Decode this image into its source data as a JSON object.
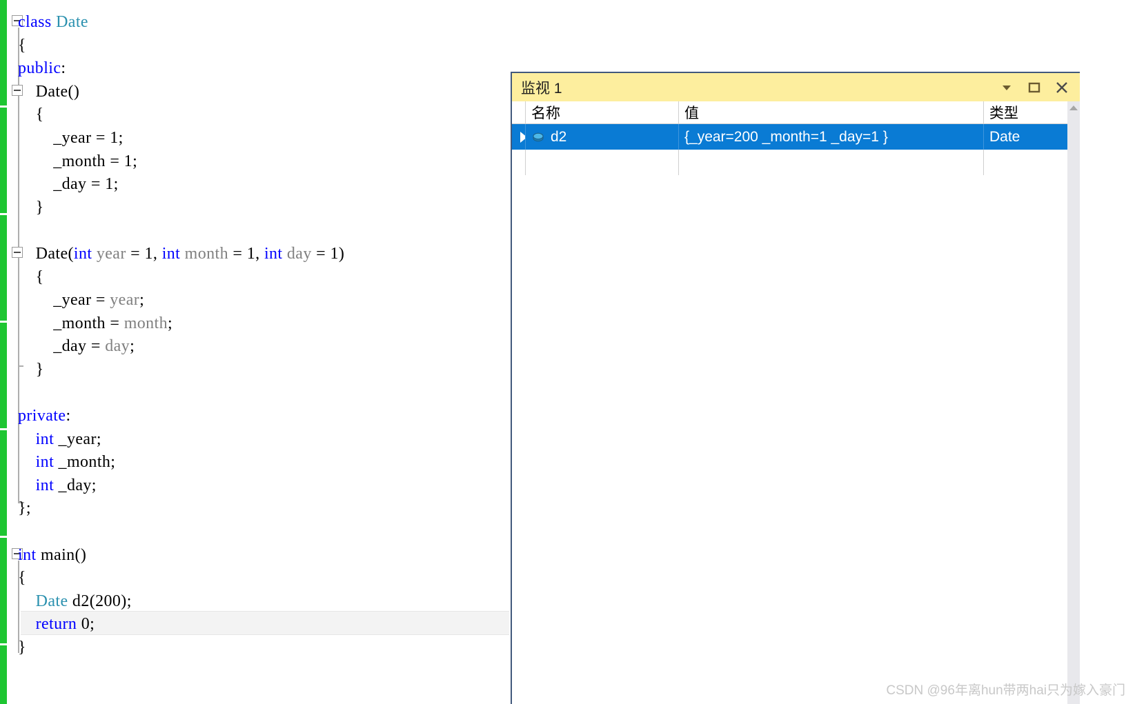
{
  "editor": {
    "language": "cpp",
    "change_bar_color": "#1ec632",
    "current_line_index": 24,
    "lines": [
      {
        "indent": 0,
        "tokens": [
          {
            "t": "class ",
            "c": "kw"
          },
          {
            "t": "Date",
            "c": "type"
          }
        ]
      },
      {
        "indent": 0,
        "tokens": [
          {
            "t": "{",
            "c": "pl"
          }
        ]
      },
      {
        "indent": 0,
        "tokens": [
          {
            "t": "public",
            "c": "kw"
          },
          {
            "t": ":",
            "c": "pl"
          }
        ]
      },
      {
        "indent": 1,
        "tokens": [
          {
            "t": "Date()",
            "c": "pl"
          }
        ]
      },
      {
        "indent": 1,
        "tokens": [
          {
            "t": "{",
            "c": "pl"
          }
        ]
      },
      {
        "indent": 2,
        "tokens": [
          {
            "t": "_year = 1;",
            "c": "pl"
          }
        ]
      },
      {
        "indent": 2,
        "tokens": [
          {
            "t": "_month = 1;",
            "c": "pl"
          }
        ]
      },
      {
        "indent": 2,
        "tokens": [
          {
            "t": "_day = 1;",
            "c": "pl"
          }
        ]
      },
      {
        "indent": 1,
        "tokens": [
          {
            "t": "}",
            "c": "pl"
          }
        ]
      },
      {
        "indent": 0,
        "tokens": []
      },
      {
        "indent": 1,
        "tokens": [
          {
            "t": "Date(",
            "c": "pl"
          },
          {
            "t": "int",
            "c": "kw"
          },
          {
            "t": " ",
            "c": "pl"
          },
          {
            "t": "year",
            "c": "param"
          },
          {
            "t": " = 1, ",
            "c": "pl"
          },
          {
            "t": "int",
            "c": "kw"
          },
          {
            "t": " ",
            "c": "pl"
          },
          {
            "t": "month",
            "c": "param"
          },
          {
            "t": " = 1, ",
            "c": "pl"
          },
          {
            "t": "int",
            "c": "kw"
          },
          {
            "t": " ",
            "c": "pl"
          },
          {
            "t": "day",
            "c": "param"
          },
          {
            "t": " = 1)",
            "c": "pl"
          }
        ]
      },
      {
        "indent": 1,
        "tokens": [
          {
            "t": "{",
            "c": "pl"
          }
        ]
      },
      {
        "indent": 2,
        "tokens": [
          {
            "t": "_year = ",
            "c": "pl"
          },
          {
            "t": "year",
            "c": "param"
          },
          {
            "t": ";",
            "c": "pl"
          }
        ]
      },
      {
        "indent": 2,
        "tokens": [
          {
            "t": "_month = ",
            "c": "pl"
          },
          {
            "t": "month",
            "c": "param"
          },
          {
            "t": ";",
            "c": "pl"
          }
        ]
      },
      {
        "indent": 2,
        "tokens": [
          {
            "t": "_day = ",
            "c": "pl"
          },
          {
            "t": "day",
            "c": "param"
          },
          {
            "t": ";",
            "c": "pl"
          }
        ]
      },
      {
        "indent": 1,
        "tokens": [
          {
            "t": "}",
            "c": "pl"
          }
        ]
      },
      {
        "indent": 0,
        "tokens": []
      },
      {
        "indent": 0,
        "tokens": [
          {
            "t": "private",
            "c": "kw"
          },
          {
            "t": ":",
            "c": "pl"
          }
        ]
      },
      {
        "indent": 1,
        "tokens": [
          {
            "t": "int",
            "c": "kw"
          },
          {
            "t": " _year;",
            "c": "pl"
          }
        ]
      },
      {
        "indent": 1,
        "tokens": [
          {
            "t": "int",
            "c": "kw"
          },
          {
            "t": " _month;",
            "c": "pl"
          }
        ]
      },
      {
        "indent": 1,
        "tokens": [
          {
            "t": "int",
            "c": "kw"
          },
          {
            "t": " _day;",
            "c": "pl"
          }
        ]
      },
      {
        "indent": 0,
        "tokens": [
          {
            "t": "};",
            "c": "pl"
          }
        ]
      },
      {
        "indent": 0,
        "tokens": []
      },
      {
        "indent": 0,
        "tokens": [
          {
            "t": "int",
            "c": "kw"
          },
          {
            "t": " main()",
            "c": "pl"
          }
        ]
      },
      {
        "indent": 0,
        "tokens": [
          {
            "t": "{",
            "c": "pl"
          }
        ]
      },
      {
        "indent": 1,
        "tokens": [
          {
            "t": "Date",
            "c": "type"
          },
          {
            "t": " d2(200);",
            "c": "pl"
          }
        ]
      },
      {
        "indent": 1,
        "tokens": [
          {
            "t": "return",
            "c": "kw"
          },
          {
            "t": " 0;",
            "c": "pl"
          }
        ]
      },
      {
        "indent": 0,
        "tokens": [
          {
            "t": "}",
            "c": "pl"
          }
        ]
      }
    ],
    "outline_boxes_label": "collapse-region-toggle"
  },
  "watch_window": {
    "title": "监视 1",
    "titlebar_buttons": [
      {
        "name": "window-menu-dropdown",
        "label": "▼"
      },
      {
        "name": "float-window",
        "label": "□"
      },
      {
        "name": "close-window",
        "label": "✕"
      }
    ],
    "columns": [
      {
        "key": "name",
        "label": "名称"
      },
      {
        "key": "value",
        "label": "值"
      },
      {
        "key": "type",
        "label": "类型"
      }
    ],
    "rows": [
      {
        "expandable": true,
        "icon": "object-icon",
        "name": "d2",
        "value": "{_year=200 _month=1 _day=1 }",
        "type": "Date",
        "selected": true
      },
      {
        "expandable": false,
        "icon": "",
        "name": "",
        "value": "",
        "type": "",
        "selected": false
      }
    ],
    "colors": {
      "titlebar": "#fdee9e",
      "selected_row": "#0a7bd4",
      "border": "#41597c"
    }
  },
  "watermark": {
    "text": "CSDN @96年离hun带两hai只为嫁入豪门"
  }
}
